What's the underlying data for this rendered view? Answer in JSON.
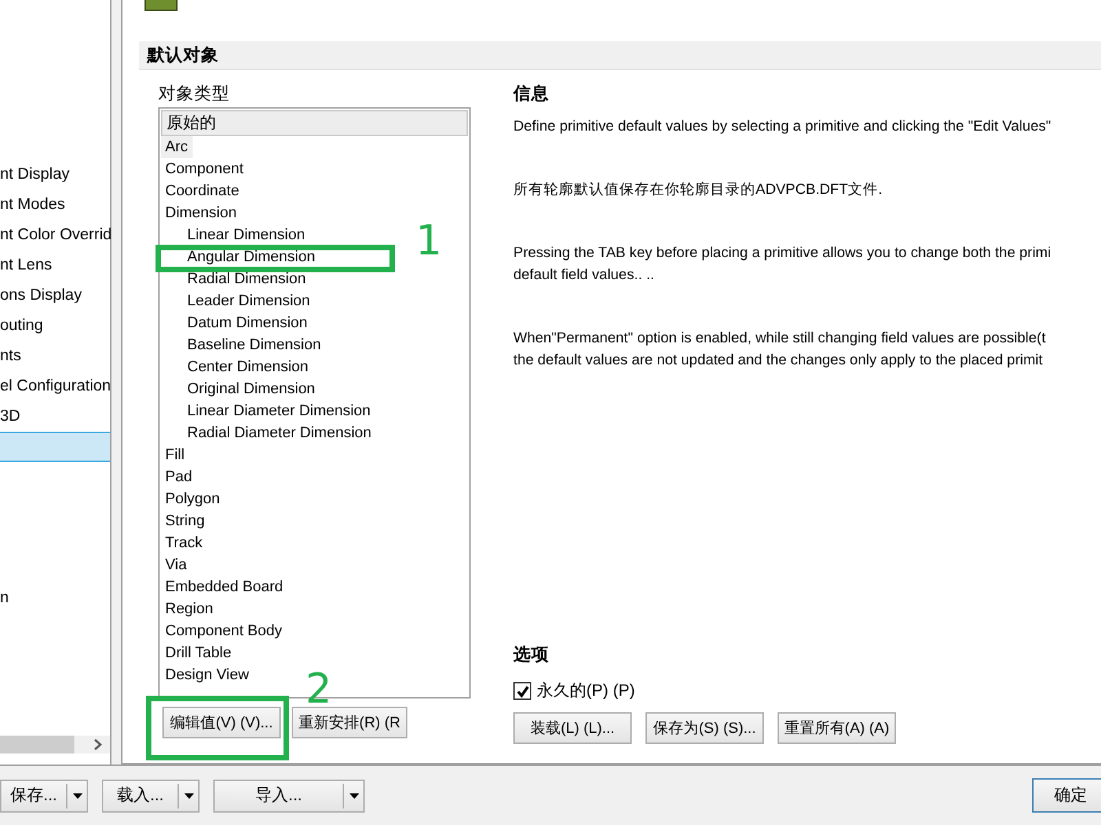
{
  "left_tree": {
    "items": [
      {
        "label": "nt Display",
        "selected": false
      },
      {
        "label": "nt Modes",
        "selected": false
      },
      {
        "label": "nt Color Overrid",
        "selected": false
      },
      {
        "label": "nt Lens",
        "selected": false
      },
      {
        "label": "ons Display",
        "selected": false
      },
      {
        "label": "outing",
        "selected": false
      },
      {
        "label": "nts",
        "selected": false
      },
      {
        "label": "el Configuration",
        "selected": false
      },
      {
        "label": "3D",
        "selected": false
      },
      {
        "selected": true
      },
      {
        "label": "n",
        "selected": false
      }
    ]
  },
  "section_title": "默认对象",
  "object_types": {
    "label": "对象类型",
    "header": "原始的",
    "items": [
      {
        "label": "Arc",
        "selected": true
      },
      {
        "label": "Component",
        "selected": false
      },
      {
        "label": "Coordinate",
        "selected": false
      },
      {
        "label": "Dimension",
        "selected": false,
        "children": [
          {
            "label": "Linear Dimension",
            "selected": false
          },
          {
            "label": "Angular Dimension",
            "selected": false
          },
          {
            "label": "Radial Dimension",
            "selected": false
          },
          {
            "label": "Leader Dimension",
            "selected": false
          },
          {
            "label": "Datum Dimension",
            "selected": false
          },
          {
            "label": "Baseline Dimension",
            "selected": false
          },
          {
            "label": "Center Dimension",
            "selected": false
          },
          {
            "label": "Original Dimension",
            "selected": false
          },
          {
            "label": "Linear Diameter Dimension",
            "selected": false
          },
          {
            "label": "Radial Diameter Dimension",
            "selected": false
          }
        ]
      },
      {
        "label": "Fill",
        "selected": false
      },
      {
        "label": "Pad",
        "selected": false
      },
      {
        "label": "Polygon",
        "selected": false
      },
      {
        "label": "String",
        "selected": false
      },
      {
        "label": "Track",
        "selected": false
      },
      {
        "label": "Via",
        "selected": false
      },
      {
        "label": "Embedded Board",
        "selected": false
      },
      {
        "label": "Region",
        "selected": false
      },
      {
        "label": "Component Body",
        "selected": false
      },
      {
        "label": "Drill Table",
        "selected": false
      },
      {
        "label": "Design View",
        "selected": false
      }
    ],
    "buttons": [
      "编辑值(V) (V)...",
      "重新安排(R) (R"
    ]
  },
  "info": {
    "title": "信息",
    "paragraphs": [
      [
        "Define primitive default values by selecting a primitive and clicking the \"Edit Values\""
      ],
      [
        "所有轮廓默认值保存在你轮廓目录的ADVPCB.DFT文件."
      ],
      [
        "Pressing the TAB key before placing a primitive allows you to change both the primi",
        "default field values.. .."
      ],
      [
        "When\"Permanent\" option is enabled, while still changing field values are possible(t",
        "the default values are not updated and the changes only apply to the placed primit"
      ]
    ]
  },
  "options": {
    "title": "选项",
    "permanent": {
      "label": "永久的(P) (P)",
      "checked": true
    },
    "buttons": [
      "装载(L) (L)...",
      "保存为(S) (S)...",
      "重置所有(A) (A)"
    ]
  },
  "bottom_bar": {
    "split_buttons": [
      "保存...",
      "载入...",
      "导入..."
    ],
    "ok": "确定"
  },
  "annotations": [
    "1",
    "2"
  ]
}
